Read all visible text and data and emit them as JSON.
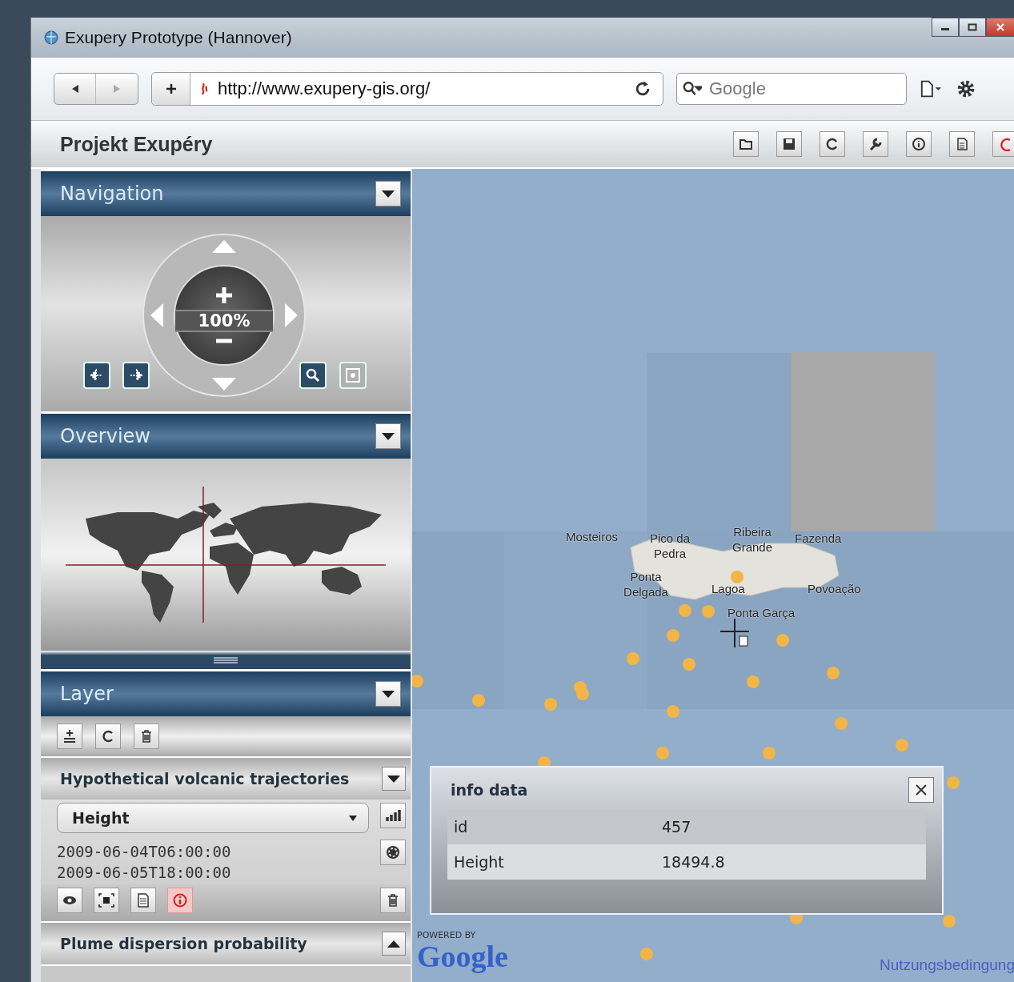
{
  "window": {
    "title": "Exupery Prototype (Hannover)"
  },
  "browser": {
    "url": "http://www.exupery-gis.org/",
    "search": {
      "placeholder": "Google"
    }
  },
  "app": {
    "title": "Projekt Exupéry"
  },
  "navigation": {
    "title": "Navigation",
    "expanded": true,
    "zoom": "100%"
  },
  "overview": {
    "title": "Overview",
    "expanded": true
  },
  "layer_panel": {
    "title": "Layer",
    "expanded": true,
    "layers": [
      {
        "name": "Hypothetical volcanic trajectories",
        "expanded": true,
        "attribute": "Height",
        "times": [
          "2009-06-04T06:00:00",
          "2009-06-05T18:00:00"
        ],
        "info_on": true
      },
      {
        "name": "Plume dispersion probability",
        "expanded": false
      }
    ]
  },
  "map": {
    "places": [
      {
        "name": "Mosteiros"
      },
      {
        "name": "Pico da Pedra"
      },
      {
        "name": "Ribeira Grande"
      },
      {
        "name": "Fazenda"
      },
      {
        "name": "Ponta Delgada"
      },
      {
        "name": "Lagoa"
      },
      {
        "name": "Povoação"
      },
      {
        "name": "Ponta Garça"
      }
    ],
    "popup": {
      "title": "info data",
      "rows": [
        {
          "key": "id",
          "value": "457"
        },
        {
          "key": "Height",
          "value": "18494.8"
        }
      ]
    },
    "powered_by": "POWERED BY",
    "logo": "Google",
    "terms_link": "Nutzungsbedingung"
  }
}
